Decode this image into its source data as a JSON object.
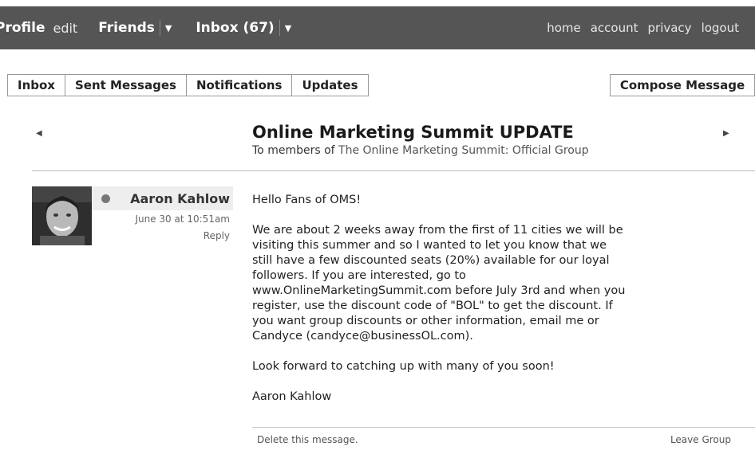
{
  "topbar": {
    "profile": "Profile",
    "edit": "edit",
    "friends": "Friends",
    "inbox": "Inbox (67)",
    "dropdown_arrow": "▼",
    "right_links": [
      "home",
      "account",
      "privacy",
      "logout"
    ]
  },
  "tabs": [
    "Inbox",
    "Sent Messages",
    "Notifications",
    "Updates"
  ],
  "compose_label": "Compose Message",
  "thread": {
    "subject": "Online Marketing Summit UPDATE",
    "to_prefix": "To members of",
    "group": "The Online Marketing Summit: Official Group"
  },
  "message": {
    "sender": "Aaron Kahlow",
    "time": "June 30 at 10:51am",
    "reply": "Reply",
    "greeting": "Hello Fans of OMS!",
    "paragraph": "We are about 2 weeks away from the first of 11 cities we will be visiting this summer and so I wanted to let you know that we still have a few discounted seats (20%) available for our loyal followers. If you are interested, go to www.OnlineMarketingSummit.com before July 3rd and when you register, use the discount code of \"BOL\" to get the discount. If you want group discounts or other information, email me or Candyce (candyce@businessOL.com).",
    "closing": "Look forward to catching up with many of you soon!",
    "signature": "Aaron Kahlow"
  },
  "footer": {
    "delete": "Delete this message.",
    "leave": "Leave Group"
  },
  "colors": {
    "topbar_bg": "#555555",
    "sender_box_bg": "#eeeeee"
  }
}
